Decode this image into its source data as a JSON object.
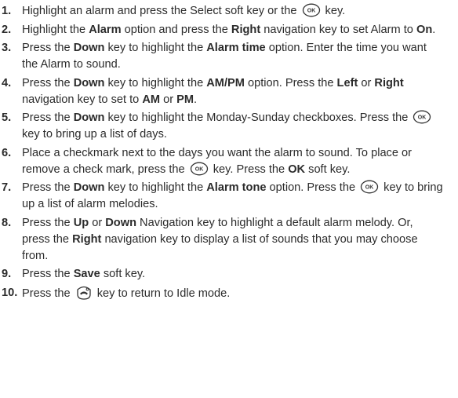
{
  "steps": [
    {
      "num": "1.",
      "parts": [
        {
          "t": "Highlight an alarm and press the Select soft key or the "
        },
        {
          "icon": "ok-key-icon"
        },
        {
          "t": " key."
        }
      ]
    },
    {
      "num": "2.",
      "parts": [
        {
          "t": "Highlight the "
        },
        {
          "t": "Alarm",
          "b": true
        },
        {
          "t": " option and press the "
        },
        {
          "t": "Right",
          "b": true
        },
        {
          "t": " navigation key to set Alarm to "
        },
        {
          "t": "On",
          "b": true
        },
        {
          "t": "."
        }
      ]
    },
    {
      "num": "3.",
      "parts": [
        {
          "t": "Press the "
        },
        {
          "t": "Down",
          "b": true
        },
        {
          "t": " key to highlight the "
        },
        {
          "t": "Alarm time",
          "b": true
        },
        {
          "t": " option. Enter the time you want the Alarm to sound."
        }
      ]
    },
    {
      "num": "4.",
      "parts": [
        {
          "t": "Press the "
        },
        {
          "t": "Down",
          "b": true
        },
        {
          "t": " key to highlight the "
        },
        {
          "t": "AM/PM",
          "b": true
        },
        {
          "t": " option. Press the "
        },
        {
          "t": "Left",
          "b": true
        },
        {
          "t": " or "
        },
        {
          "t": "Right",
          "b": true
        },
        {
          "t": " navigation key to set to "
        },
        {
          "t": "AM",
          "b": true
        },
        {
          "t": " or "
        },
        {
          "t": "PM",
          "b": true
        },
        {
          "t": "."
        }
      ]
    },
    {
      "num": "5.",
      "parts": [
        {
          "t": "Press the "
        },
        {
          "t": "Down",
          "b": true
        },
        {
          "t": " key to highlight the Monday-Sunday checkboxes. Press the "
        },
        {
          "icon": "ok-key-icon"
        },
        {
          "t": " key to bring up a list of days."
        }
      ]
    },
    {
      "num": "6.",
      "parts": [
        {
          "t": "Place a checkmark next to the days you want the alarm to sound. To place or remove a check mark, press the "
        },
        {
          "icon": "ok-key-icon"
        },
        {
          "t": " key. Press the "
        },
        {
          "t": "OK",
          "b": true
        },
        {
          "t": " soft key."
        }
      ]
    },
    {
      "num": "7.",
      "parts": [
        {
          "t": "Press the "
        },
        {
          "t": "Down",
          "b": true
        },
        {
          "t": " key to highlight the "
        },
        {
          "t": "Alarm tone",
          "b": true
        },
        {
          "t": " option. Press the "
        },
        {
          "icon": "ok-key-icon"
        },
        {
          "t": " key to bring up a list of alarm melodies."
        }
      ]
    },
    {
      "num": "8.",
      "parts": [
        {
          "t": "Press the "
        },
        {
          "t": "Up",
          "b": true
        },
        {
          "t": " or "
        },
        {
          "t": "Down",
          "b": true
        },
        {
          "t": " Navigation key to highlight a default alarm melody. Or, press the "
        },
        {
          "t": "Right",
          "b": true
        },
        {
          "t": " navigation key to display a list of sounds that you may choose from."
        }
      ]
    },
    {
      "num": "9.",
      "parts": [
        {
          "t": "Press the "
        },
        {
          "t": "Save",
          "b": true
        },
        {
          "t": " soft key."
        }
      ]
    },
    {
      "num": "10.",
      "parts": [
        {
          "t": "Press the "
        },
        {
          "icon": "end-key-icon"
        },
        {
          "t": " key to return to Idle mode."
        }
      ]
    }
  ],
  "icons": {
    "ok-key-icon": {
      "label": "OK"
    },
    "end-key-icon": {
      "label": ""
    }
  },
  "colors": {
    "text": "#2b2b2b",
    "icon_stroke": "#333333"
  }
}
